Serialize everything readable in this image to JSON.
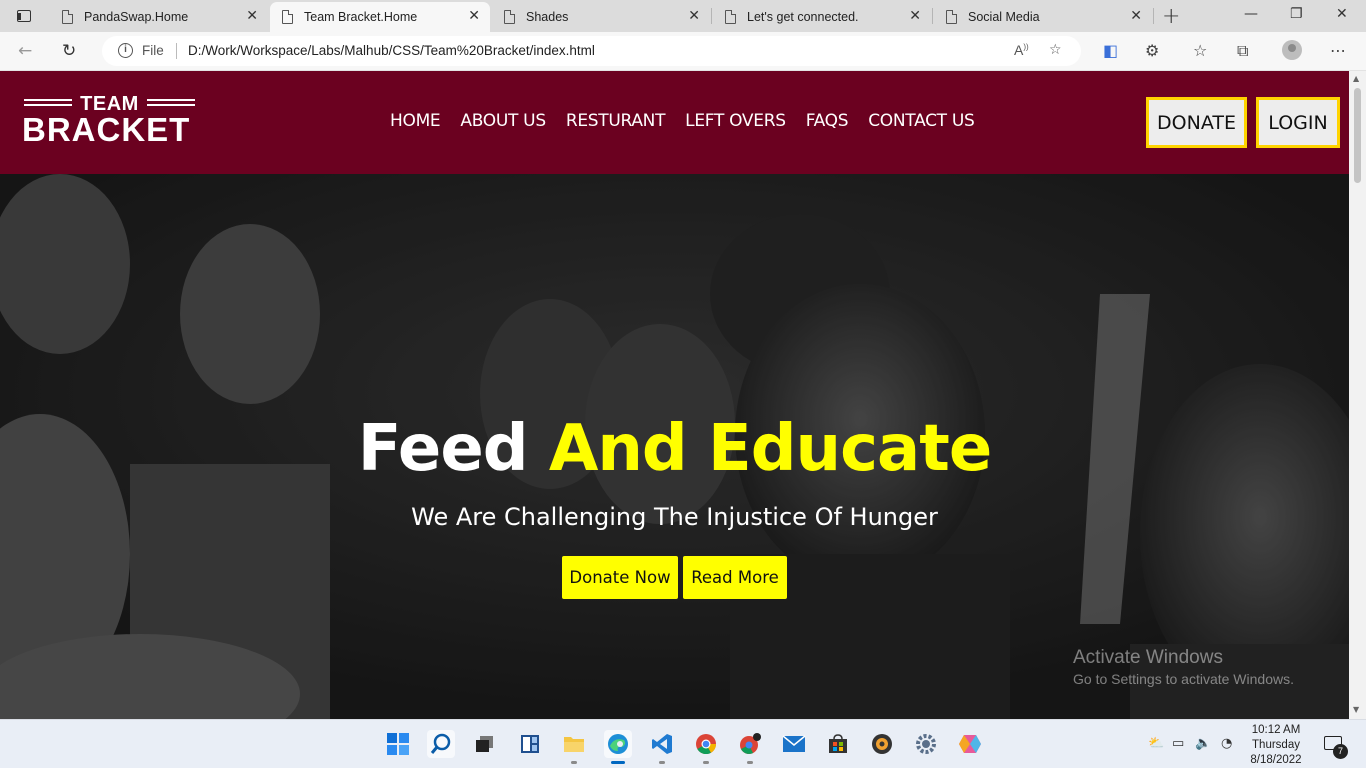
{
  "browser": {
    "tabs": [
      {
        "title": "PandaSwap.Home",
        "active": false
      },
      {
        "title": "Team Bracket.Home",
        "active": true
      },
      {
        "title": "Shades",
        "active": false
      },
      {
        "title": "Let's get connected.",
        "active": false
      },
      {
        "title": "Social Media",
        "active": false
      }
    ],
    "address": {
      "scheme_label": "File",
      "url": "D:/Work/Workspace/Labs/Malhub/CSS/Team%20Bracket/index.html"
    }
  },
  "site": {
    "logo": {
      "top": "TEAM",
      "bottom": "BRACKET"
    },
    "menu": [
      "HOME",
      "ABOUT US",
      "RESTURANT",
      "LEFT OVERS",
      "FAQS",
      "CONTACT US"
    ],
    "donate_label": "DONATE",
    "login_label": "LOGIN",
    "colors": {
      "nav_bg": "#6b0120",
      "accent_yellow": "#ffff00",
      "button_border": "#ffd400"
    }
  },
  "hero": {
    "title_white": "Feed",
    "title_yellow": "And Educate",
    "subtitle": "We Are Challenging The Injustice Of Hunger",
    "buttons": [
      "Donate Now",
      "Read More"
    ]
  },
  "watermark": {
    "line1": "Activate Windows",
    "line2": "Go to Settings to activate Windows."
  },
  "taskbar": {
    "apps": [
      "windows-start-icon",
      "search-icon",
      "task-view-icon",
      "widgets-icon",
      "file-explorer-icon",
      "edge-browser-icon",
      "vscode-icon",
      "chrome-icon",
      "chrome-dev-icon",
      "mail-icon",
      "microsoft-store-icon",
      "media-player-icon",
      "settings-icon",
      "app-icon"
    ],
    "clock": {
      "time": "10:12 AM",
      "day": "Thursday",
      "date": "8/18/2022"
    },
    "notification_count": "7"
  }
}
